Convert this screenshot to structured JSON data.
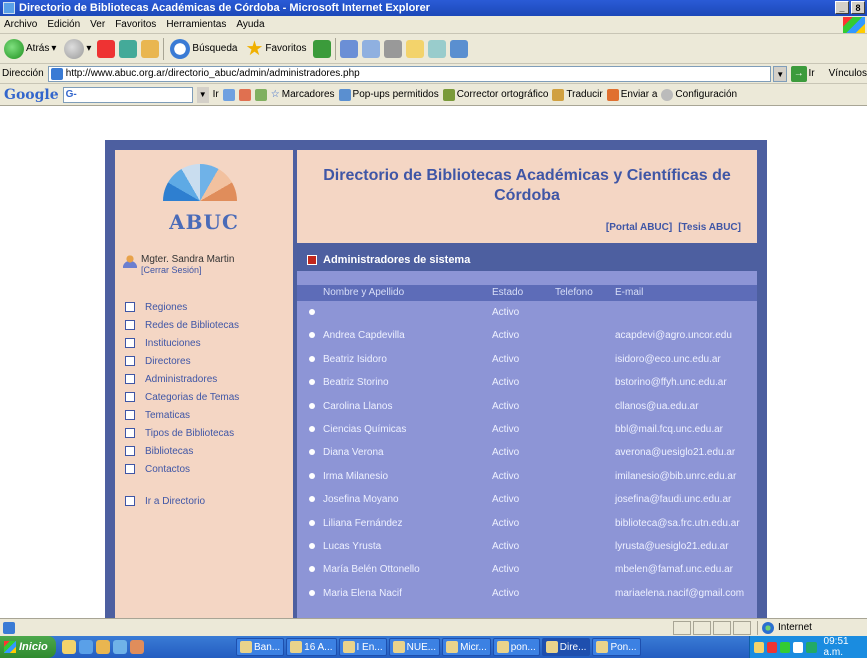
{
  "window": {
    "title": "Directorio de Bibliotecas Académicas de Córdoba - Microsoft Internet Explorer",
    "min": "_",
    "max": "8"
  },
  "menubar": [
    "Archivo",
    "Edición",
    "Ver",
    "Favoritos",
    "Herramientas",
    "Ayuda"
  ],
  "toolbar": {
    "back": "Atrás",
    "search": "Búsqueda",
    "favorites": "Favoritos"
  },
  "address": {
    "label": "Dirección",
    "url": "http://www.abuc.org.ar/directorio_abuc/admin/administradores.php",
    "go": "Ir",
    "links": "Vínculos"
  },
  "googlebar": {
    "logo": "Google",
    "search_value": "G-",
    "go": "Ir",
    "bookmarks": "Marcadores",
    "popups": "Pop-ups permitidos",
    "spell": "Corrector ortográfico",
    "translate": "Traducir",
    "send": "Enviar a",
    "settings": "Configuración"
  },
  "site": {
    "logo_text": "ABUC",
    "title": "Directorio de Bibliotecas Académicas y Científicas de Córdoba",
    "links": [
      "[Portal ABUC]",
      "[Tesis ABUC]"
    ],
    "user": {
      "name": "Mgter. Sandra Martin",
      "logout": "[Cerrar Sesión]"
    },
    "nav": [
      "Regiones",
      "Redes de Bibliotecas",
      "Instituciones",
      "Directores",
      "Administradores",
      "Categorias de Temas",
      "Tematicas",
      "Tipos de Bibliotecas",
      "Bibliotecas",
      "Contactos"
    ],
    "nav_extra": "Ir a Directorio",
    "section_title": "Administradores de sistema",
    "table": {
      "headers": [
        "Nombre y Apellido",
        "Estado",
        "Telefono",
        "E-mail"
      ],
      "rows": [
        {
          "name": "",
          "state": "Activo",
          "phone": "",
          "mail": ""
        },
        {
          "name": "Andrea Capdevilla",
          "state": "Activo",
          "phone": "",
          "mail": "acapdevi@agro.uncor.edu"
        },
        {
          "name": "Beatriz Isidoro",
          "state": "Activo",
          "phone": "",
          "mail": "isidoro@eco.unc.edu.ar"
        },
        {
          "name": "Beatriz Storino",
          "state": "Activo",
          "phone": "",
          "mail": "bstorino@ffyh.unc.edu.ar"
        },
        {
          "name": "Carolina Llanos",
          "state": "Activo",
          "phone": "",
          "mail": "cllanos@ua.edu.ar"
        },
        {
          "name": "Ciencias Químicas",
          "state": "Activo",
          "phone": "",
          "mail": "bbl@mail.fcq.unc.edu.ar"
        },
        {
          "name": "Diana Verona",
          "state": "Activo",
          "phone": "",
          "mail": "averona@uesiglo21.edu.ar"
        },
        {
          "name": "Irma Milanesio",
          "state": "Activo",
          "phone": "",
          "mail": "imilanesio@bib.unrc.edu.ar"
        },
        {
          "name": "Josefina Moyano",
          "state": "Activo",
          "phone": "",
          "mail": "josefina@faudi.unc.edu.ar"
        },
        {
          "name": "Liliana Fernández",
          "state": "Activo",
          "phone": "",
          "mail": "biblioteca@sa.frc.utn.edu.ar"
        },
        {
          "name": "Lucas Yrusta",
          "state": "Activo",
          "phone": "",
          "mail": "lyrusta@uesiglo21.edu.ar"
        },
        {
          "name": "María Belén Ottonello",
          "state": "Activo",
          "phone": "",
          "mail": "mbelen@famaf.unc.edu.ar"
        },
        {
          "name": "Maria Elena Nacif",
          "state": "Activo",
          "phone": "",
          "mail": "mariaelena.nacif@gmail.com"
        }
      ]
    }
  },
  "statusbar": {
    "zone": "Internet"
  },
  "taskbar": {
    "start": "Inicio",
    "tasks": [
      "Ban...",
      "16 A...",
      "I En...",
      "NUE...",
      "Micr...",
      "pon...",
      "Dire...",
      "Pon..."
    ],
    "clock": "09:51 a.m."
  }
}
